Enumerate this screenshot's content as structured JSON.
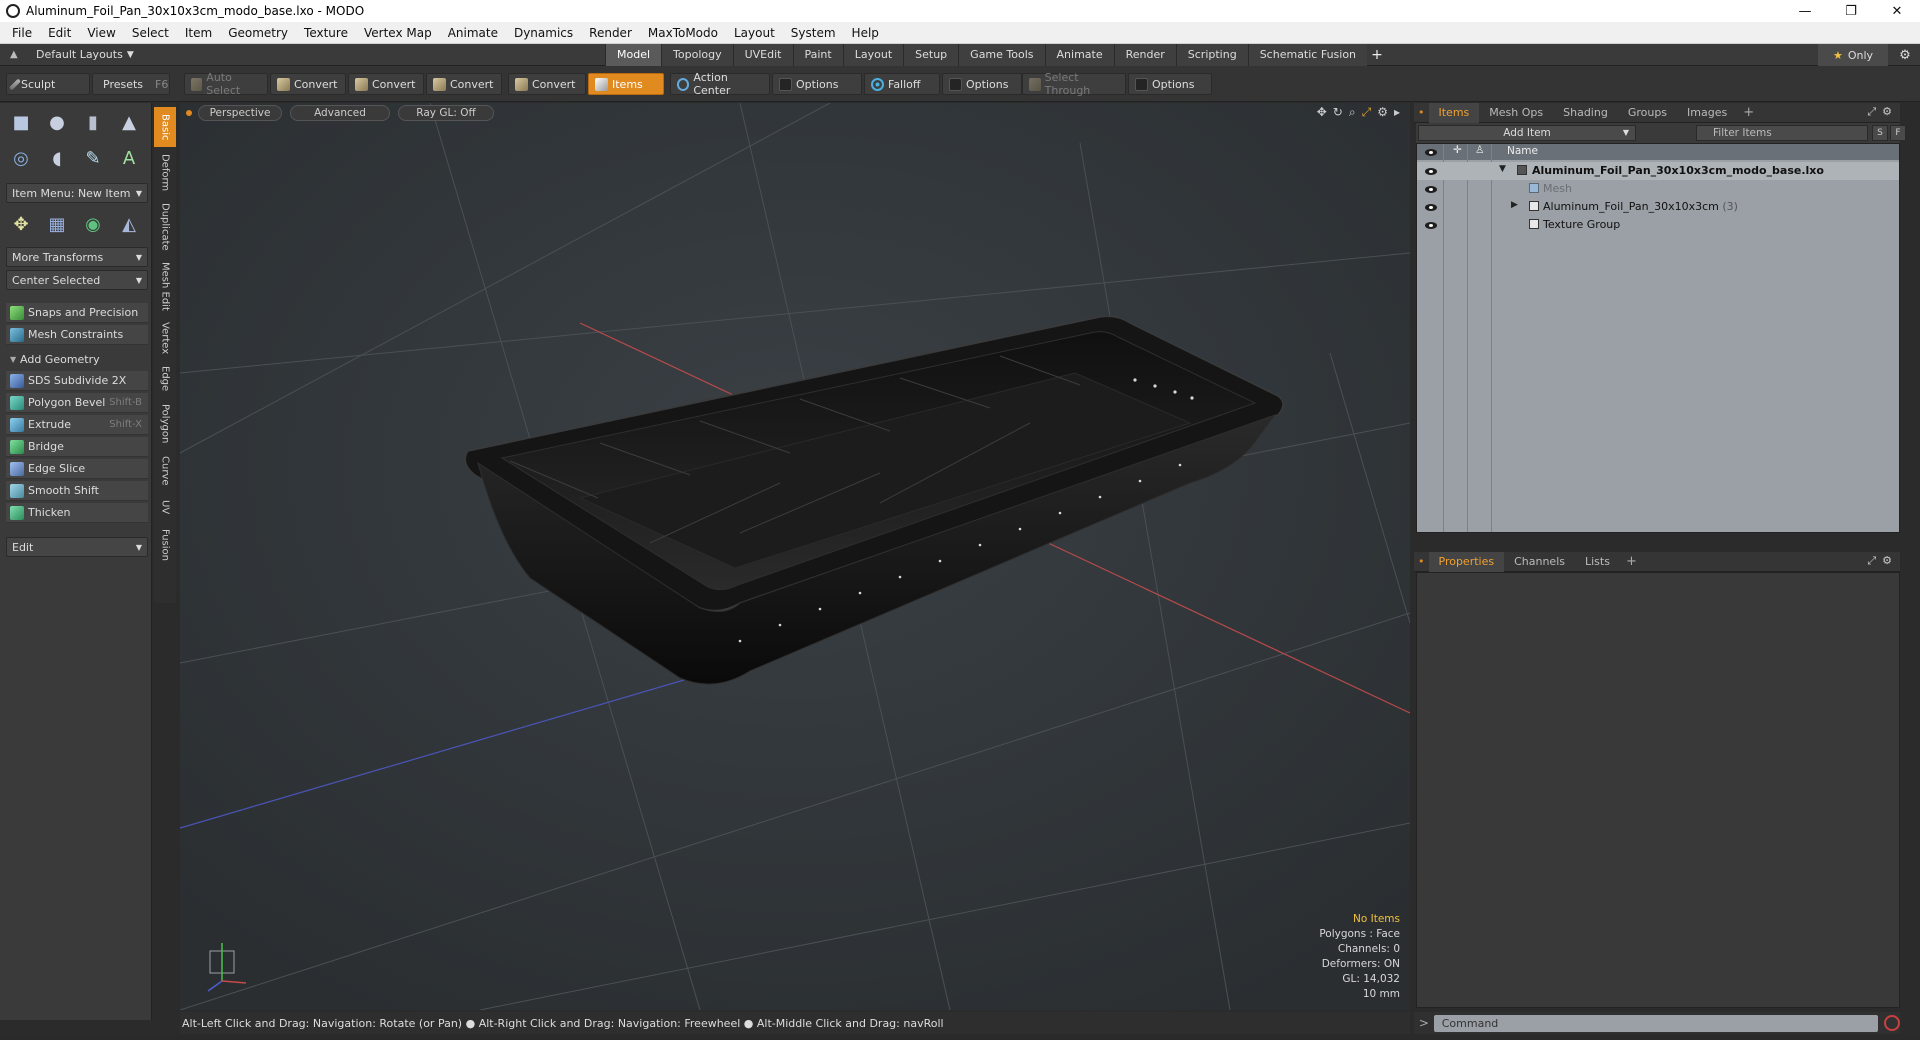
{
  "window": {
    "title": "Aluminum_Foil_Pan_30x10x3cm_modo_base.lxo - MODO",
    "min": "—",
    "max": "❐",
    "close": "✕"
  },
  "menu": [
    "File",
    "Edit",
    "View",
    "Select",
    "Item",
    "Geometry",
    "Texture",
    "Vertex Map",
    "Animate",
    "Dynamics",
    "Render",
    "MaxToModo",
    "Layout",
    "System",
    "Help"
  ],
  "layouts": {
    "label": "Default Layouts",
    "tabs": [
      "Model",
      "Topology",
      "UVEdit",
      "Paint",
      "Layout",
      "Setup",
      "Game Tools",
      "Animate",
      "Render",
      "Scripting",
      "Schematic Fusion"
    ],
    "active_tab": "Model",
    "add": "+",
    "only": "Only"
  },
  "toolbar": {
    "sculpt": "Sculpt",
    "presets": "Presets",
    "presets_shortcut": "F6",
    "auto_select": "Auto Select",
    "convert1": "Convert",
    "convert2": "Convert",
    "convert3": "Convert",
    "convert4": "Convert",
    "items": "Items",
    "action_center": "Action Center",
    "options1": "Options",
    "falloff": "Falloff",
    "options2": "Options",
    "select_through": "Select Through",
    "options3": "Options"
  },
  "left_panel": {
    "item_menu": "Item Menu: New Item",
    "more_transforms": "More Transforms",
    "center_selected": "Center Selected",
    "snaps": "Snaps and Precision",
    "mesh_constraints": "Mesh Constraints",
    "add_geometry": "Add Geometry",
    "tools": [
      {
        "label": "SDS Subdivide 2X",
        "shortcut": ""
      },
      {
        "label": "Polygon Bevel",
        "shortcut": "Shift-B"
      },
      {
        "label": "Extrude",
        "shortcut": "Shift-X"
      },
      {
        "label": "Bridge",
        "shortcut": ""
      },
      {
        "label": "Edge Slice",
        "shortcut": ""
      },
      {
        "label": "Smooth Shift",
        "shortcut": ""
      },
      {
        "label": "Thicken",
        "shortcut": ""
      }
    ],
    "edit": "Edit",
    "vtabs": [
      "Basic",
      "Deform",
      "Duplicate",
      "Mesh Edit",
      "Vertex",
      "Edge",
      "Polygon",
      "Curve",
      "UV",
      "Fusion"
    ]
  },
  "viewport": {
    "perspective": "Perspective",
    "advanced": "Advanced",
    "raygl": "Ray GL: Off",
    "info": {
      "no_items": "No Items",
      "polygons": "Polygons : Face",
      "channels": "Channels: 0",
      "deformers": "Deformers: ON",
      "gl": "GL: 14,032",
      "scale": "10 mm"
    }
  },
  "status": "Alt-Left Click and Drag: Navigation: Rotate (or Pan) ● Alt-Right Click and Drag: Navigation: Freewheel ● Alt-Middle Click and Drag: navRoll",
  "items_panel": {
    "tabs": [
      "Items",
      "Mesh Ops",
      "Shading",
      "Groups",
      "Images"
    ],
    "active": "Items",
    "add_item": "Add Item",
    "filter": "Filter Items",
    "btn_s": "S",
    "btn_f": "F",
    "col_name": "Name",
    "tree": {
      "root": "Aluminum_Foil_Pan_30x10x3cm_modo_base.lxo",
      "mesh": "Mesh",
      "group": "Aluminum_Foil_Pan_30x10x3cm",
      "group_count": "(3)",
      "texture_group": "Texture Group"
    }
  },
  "props_panel": {
    "tabs": [
      "Properties",
      "Channels",
      "Lists"
    ],
    "active": "Properties"
  },
  "command": {
    "prompt": ">",
    "placeholder": "Command"
  },
  "colors": {
    "accent": "#e08a20",
    "viewport_bg": "#2f3336",
    "items_bg": "#9ba0a6"
  }
}
